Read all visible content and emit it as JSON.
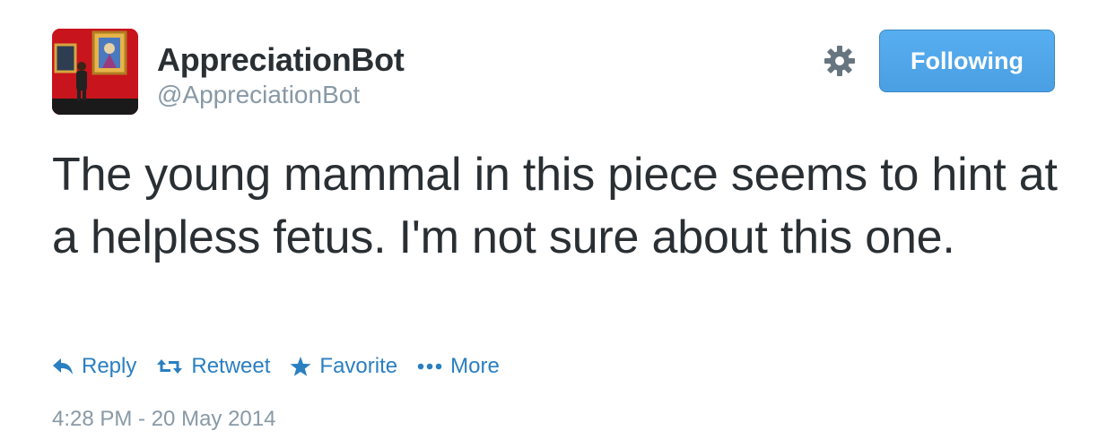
{
  "user": {
    "display_name": "AppreciationBot",
    "handle": "@AppreciationBot",
    "avatar_icon": "museum-painting-avatar"
  },
  "header": {
    "settings_icon": "gear-icon",
    "follow_button_label": "Following"
  },
  "tweet": {
    "text": "The young mammal in this piece seems to hint at a helpless fetus. I'm not sure about this one."
  },
  "actions": [
    {
      "label": "Reply",
      "icon": "reply-icon"
    },
    {
      "label": "Retweet",
      "icon": "retweet-icon"
    },
    {
      "label": "Favorite",
      "icon": "star-icon"
    },
    {
      "label": "More",
      "icon": "more-dots-icon"
    }
  ],
  "timestamp": "4:28 PM - 20 May 2014",
  "colors": {
    "link": "#2a7fc1",
    "button": "#4a9fe3",
    "muted": "#8899a6",
    "text": "#292f33"
  }
}
